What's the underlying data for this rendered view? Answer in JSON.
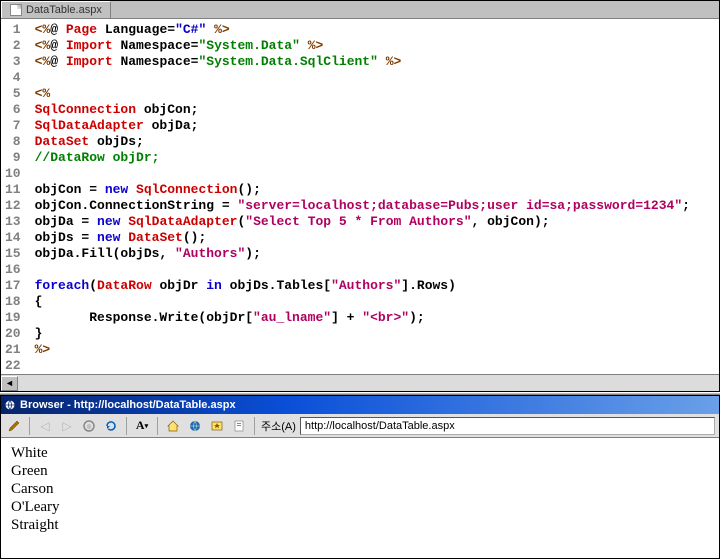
{
  "editor": {
    "tab_title": "DataTable.aspx",
    "line_count": 22,
    "code_lines": [
      {
        "n": 1,
        "segments": [
          {
            "t": "<%",
            "c": "kw-brown"
          },
          {
            "t": "@ ",
            "c": ""
          },
          {
            "t": "Page",
            "c": "kw-red"
          },
          {
            "t": " Language=",
            "c": ""
          },
          {
            "t": "\"C#\"",
            "c": "kw-blue"
          },
          {
            "t": " %>",
            "c": "kw-brown"
          }
        ]
      },
      {
        "n": 2,
        "segments": [
          {
            "t": "<%",
            "c": "kw-brown"
          },
          {
            "t": "@ ",
            "c": ""
          },
          {
            "t": "Import",
            "c": "kw-red"
          },
          {
            "t": " Namespace=",
            "c": ""
          },
          {
            "t": "\"System.Data\"",
            "c": "kw-green"
          },
          {
            "t": " %>",
            "c": "kw-brown"
          }
        ]
      },
      {
        "n": 3,
        "segments": [
          {
            "t": "<%",
            "c": "kw-brown"
          },
          {
            "t": "@ ",
            "c": ""
          },
          {
            "t": "Import",
            "c": "kw-red"
          },
          {
            "t": " Namespace=",
            "c": ""
          },
          {
            "t": "\"System.Data.SqlClient\"",
            "c": "kw-green"
          },
          {
            "t": " %>",
            "c": "kw-brown"
          }
        ]
      },
      {
        "n": 4,
        "segments": []
      },
      {
        "n": 5,
        "segments": [
          {
            "t": "<%",
            "c": "kw-brown"
          }
        ]
      },
      {
        "n": 6,
        "segments": [
          {
            "t": "SqlConnection",
            "c": "kw-red"
          },
          {
            "t": " objCon;",
            "c": ""
          }
        ]
      },
      {
        "n": 7,
        "segments": [
          {
            "t": "SqlDataAdapter",
            "c": "kw-red"
          },
          {
            "t": " objDa;",
            "c": ""
          }
        ]
      },
      {
        "n": 8,
        "segments": [
          {
            "t": "DataSet",
            "c": "kw-red"
          },
          {
            "t": " objDs;",
            "c": ""
          }
        ]
      },
      {
        "n": 9,
        "segments": [
          {
            "t": "//DataRow objDr;",
            "c": "comment"
          }
        ]
      },
      {
        "n": 10,
        "segments": []
      },
      {
        "n": 11,
        "segments": [
          {
            "t": "objCon = ",
            "c": ""
          },
          {
            "t": "new",
            "c": "kw-blue"
          },
          {
            "t": " ",
            "c": ""
          },
          {
            "t": "SqlConnection",
            "c": "kw-red"
          },
          {
            "t": "();",
            "c": ""
          }
        ]
      },
      {
        "n": 12,
        "segments": [
          {
            "t": "objCon.ConnectionString = ",
            "c": ""
          },
          {
            "t": "\"server=localhost;database=Pubs;user id=sa;password=1234\"",
            "c": "str"
          },
          {
            "t": ";",
            "c": ""
          }
        ]
      },
      {
        "n": 13,
        "segments": [
          {
            "t": "objDa = ",
            "c": ""
          },
          {
            "t": "new",
            "c": "kw-blue"
          },
          {
            "t": " ",
            "c": ""
          },
          {
            "t": "SqlDataAdapter",
            "c": "kw-red"
          },
          {
            "t": "(",
            "c": ""
          },
          {
            "t": "\"Select Top 5 * From Authors\"",
            "c": "str"
          },
          {
            "t": ", objCon);",
            "c": ""
          }
        ]
      },
      {
        "n": 14,
        "segments": [
          {
            "t": "objDs = ",
            "c": ""
          },
          {
            "t": "new",
            "c": "kw-blue"
          },
          {
            "t": " ",
            "c": ""
          },
          {
            "t": "DataSet",
            "c": "kw-red"
          },
          {
            "t": "();",
            "c": ""
          }
        ]
      },
      {
        "n": 15,
        "segments": [
          {
            "t": "objDa.Fill(objDs, ",
            "c": ""
          },
          {
            "t": "\"Authors\"",
            "c": "str"
          },
          {
            "t": ");",
            "c": ""
          }
        ]
      },
      {
        "n": 16,
        "segments": []
      },
      {
        "n": 17,
        "segments": [
          {
            "t": "foreach",
            "c": "kw-blue"
          },
          {
            "t": "(",
            "c": ""
          },
          {
            "t": "DataRow",
            "c": "kw-red"
          },
          {
            "t": " objDr ",
            "c": ""
          },
          {
            "t": "in",
            "c": "kw-blue"
          },
          {
            "t": " objDs.Tables[",
            "c": ""
          },
          {
            "t": "\"Authors\"",
            "c": "str"
          },
          {
            "t": "].Rows)",
            "c": ""
          }
        ]
      },
      {
        "n": 18,
        "segments": [
          {
            "t": "{",
            "c": ""
          }
        ]
      },
      {
        "n": 19,
        "segments": [
          {
            "t": "       Response.Write(objDr[",
            "c": ""
          },
          {
            "t": "\"au_lname\"",
            "c": "str"
          },
          {
            "t": "] + ",
            "c": ""
          },
          {
            "t": "\"<br>\"",
            "c": "str"
          },
          {
            "t": ");",
            "c": ""
          }
        ]
      },
      {
        "n": 20,
        "segments": [
          {
            "t": "}",
            "c": ""
          }
        ]
      },
      {
        "n": 21,
        "segments": [
          {
            "t": "%>",
            "c": "kw-brown"
          }
        ]
      },
      {
        "n": 22,
        "segments": []
      }
    ]
  },
  "browser": {
    "title": "Browser - http://localhost/DataTable.aspx",
    "address_label": "주소(A)",
    "address_value": "http://localhost/DataTable.aspx",
    "output_lines": [
      "White",
      "Green",
      "Carson",
      "O'Leary",
      "Straight"
    ]
  }
}
